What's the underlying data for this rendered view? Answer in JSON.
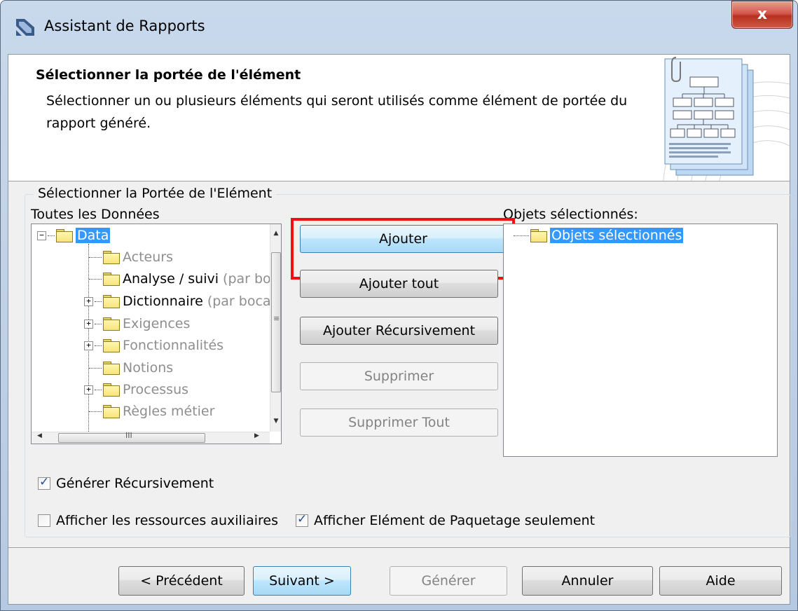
{
  "window": {
    "title": "Assistant de Rapports",
    "close_label": "x"
  },
  "header": {
    "title": "Sélectionner la portée de l'élément",
    "description": "Sélectionner un ou plusieurs éléments qui seront utilisés comme élément de portée du rapport généré."
  },
  "group": {
    "legend": "Sélectionner la Portée de l'Elément",
    "all_label": "Toutes les Données",
    "selected_label": "Objets sélectionnés:"
  },
  "tree_all": {
    "root": "Data",
    "items": [
      {
        "label": "Acteurs",
        "suffix": "",
        "expandable": false,
        "dimmed": true
      },
      {
        "label": "Analyse / suivi",
        "suffix": "(par boc",
        "expandable": false,
        "dimmed": false
      },
      {
        "label": "Dictionnaire",
        "suffix": "(par bocar",
        "expandable": true,
        "dimmed": false
      },
      {
        "label": "Exigences",
        "suffix": "",
        "expandable": true,
        "dimmed": true
      },
      {
        "label": "Fonctionnalités",
        "suffix": "",
        "expandable": true,
        "dimmed": true
      },
      {
        "label": "Notions",
        "suffix": "",
        "expandable": false,
        "dimmed": true
      },
      {
        "label": "Processus",
        "suffix": "",
        "expandable": true,
        "dimmed": true
      },
      {
        "label": "Règles métier",
        "suffix": "",
        "expandable": false,
        "dimmed": true
      }
    ],
    "hscroll_grip": "III"
  },
  "tree_selected": {
    "root": "Objets sélectionnés"
  },
  "buttons": {
    "add": "Ajouter",
    "add_all": "Ajouter tout",
    "add_recursive": "Ajouter Récursivement",
    "remove": "Supprimer",
    "remove_all": "Supprimer Tout"
  },
  "checkboxes": {
    "generate_recursive": {
      "label": "Générer Récursivement",
      "checked": true
    },
    "show_aux": {
      "label": "Afficher les ressources auxiliaires",
      "checked": false
    },
    "show_package_only": {
      "label": "Afficher Elément de Paquetage seulement",
      "checked": true
    }
  },
  "footer": {
    "previous": "< Précédent",
    "next": "Suivant >",
    "generate": "Générer",
    "cancel": "Annuler",
    "help": "Aide"
  },
  "colors": {
    "highlight": "#ee1111",
    "selection": "#3399ff",
    "folder": "#f7e47a"
  }
}
